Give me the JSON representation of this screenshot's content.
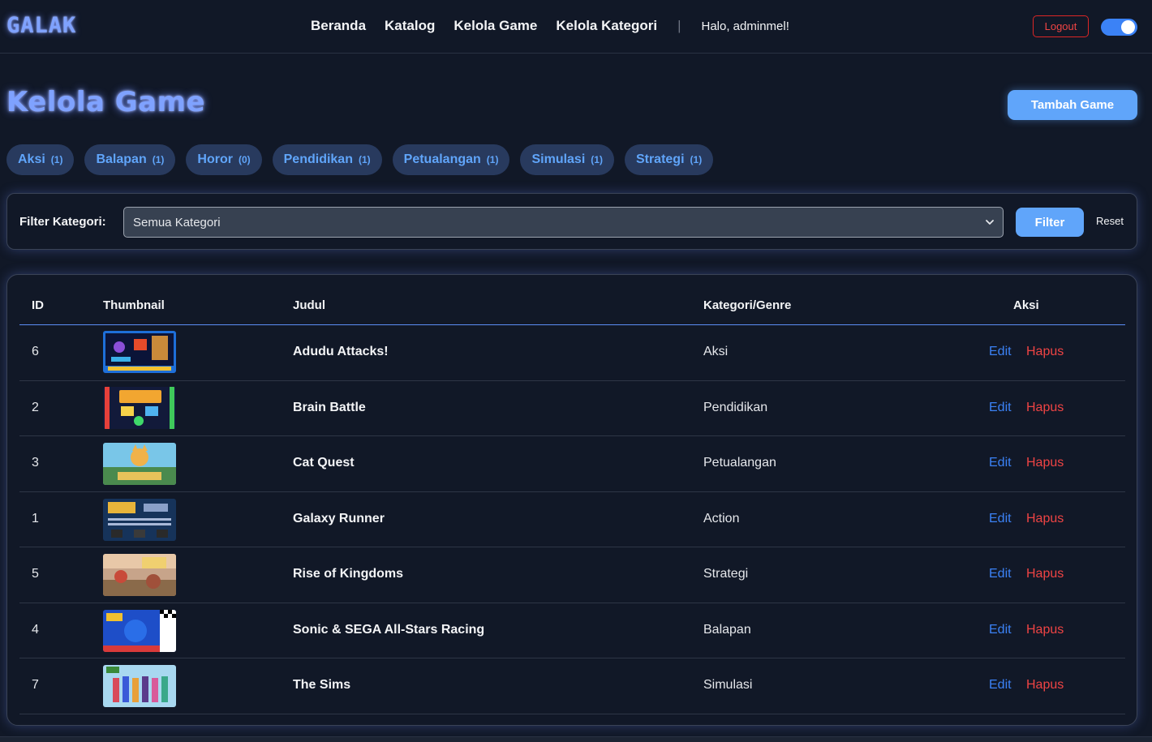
{
  "navbar": {
    "brand": "GALAK",
    "links": [
      "Beranda",
      "Katalog",
      "Kelola Game",
      "Kelola Kategori"
    ],
    "separator": "|",
    "greeting": "Halo, adminmel!",
    "logout_label": "Logout",
    "theme_toggle_on": true
  },
  "header": {
    "title": "Kelola Game",
    "add_button_label": "Tambah Game"
  },
  "categories": [
    {
      "name": "Aksi",
      "count": "(1)"
    },
    {
      "name": "Balapan",
      "count": "(1)"
    },
    {
      "name": "Horor",
      "count": "(0)"
    },
    {
      "name": "Pendidikan",
      "count": "(1)"
    },
    {
      "name": "Petualangan",
      "count": "(1)"
    },
    {
      "name": "Simulasi",
      "count": "(1)"
    },
    {
      "name": "Strategi",
      "count": "(1)"
    }
  ],
  "filter": {
    "label": "Filter Kategori:",
    "selected": "Semua Kategori",
    "filter_button": "Filter",
    "reset_button": "Reset"
  },
  "table": {
    "headers": {
      "id": "ID",
      "thumbnail": "Thumbnail",
      "title": "Judul",
      "category": "Kategori/Genre",
      "actions": "Aksi"
    },
    "edit_label": "Edit",
    "delete_label": "Hapus",
    "rows": [
      {
        "id": "6",
        "title": "Adudu Attacks!",
        "category": "Aksi"
      },
      {
        "id": "2",
        "title": "Brain Battle",
        "category": "Pendidikan"
      },
      {
        "id": "3",
        "title": "Cat Quest",
        "category": "Petualangan"
      },
      {
        "id": "1",
        "title": "Galaxy Runner",
        "category": "Action"
      },
      {
        "id": "5",
        "title": "Rise of Kingdoms",
        "category": "Strategi"
      },
      {
        "id": "4",
        "title": "Sonic & SEGA All-Stars Racing",
        "category": "Balapan"
      },
      {
        "id": "7",
        "title": "The Sims",
        "category": "Simulasi"
      }
    ]
  },
  "colors": {
    "background": "#111827",
    "accent": "#60a5fa",
    "brand_glow": "#7fa2ff",
    "pill_bg": "#283a5e",
    "danger": "#ef4444",
    "link": "#3b82f6"
  }
}
